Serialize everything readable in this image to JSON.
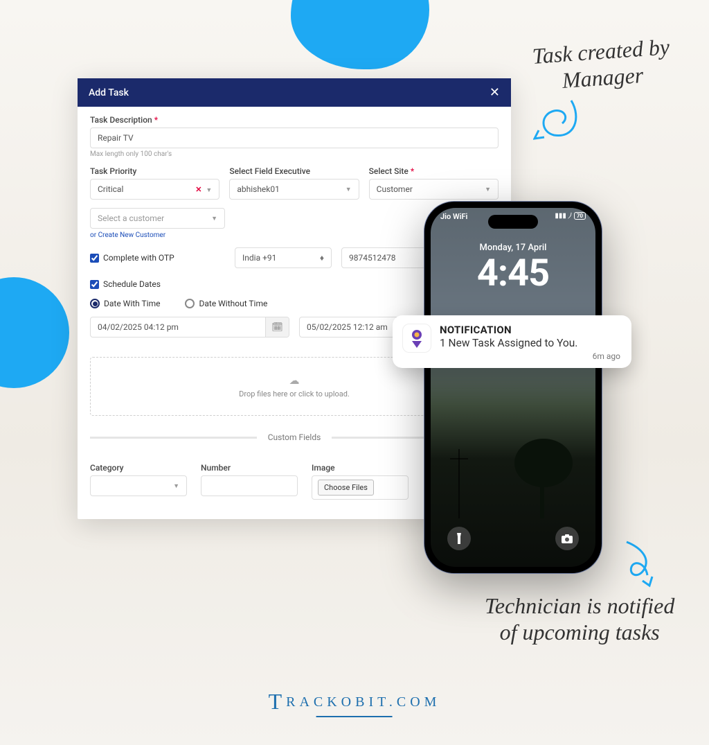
{
  "annotations": {
    "top": "Task created by\nManager",
    "bottom": "Technician is notified\nof upcoming tasks"
  },
  "modal": {
    "title": "Add Task",
    "task_desc_label": "Task Description",
    "task_desc_value": "Repair TV",
    "task_desc_hint": "Max length only 100 char's",
    "priority_label": "Task Priority",
    "priority_value": "Critical",
    "executive_label": "Select Field Executive",
    "executive_value": "abhishek01",
    "site_label": "Select Site",
    "site_value": "Customer",
    "customer_placeholder": "Select a customer",
    "create_customer_link": "or Create New Customer",
    "otp_label": "Complete with OTP",
    "phone_code": "India +91",
    "phone_number": "9874512478",
    "schedule_label": "Schedule Dates",
    "date_with_time": "Date With Time",
    "date_without_time": "Date Without Time",
    "start_date": "04/02/2025 04:12 pm",
    "end_date": "05/02/2025 12:12 am",
    "dropzone": "Drop files here or click to upload.",
    "custom_fields_label": "Custom Fields",
    "category_label": "Category",
    "number_label": "Number",
    "image_label": "Image",
    "choose_files": "Choose Files"
  },
  "phone": {
    "carrier": "Jio WiFi",
    "battery": "70",
    "date": "Monday, 17 April",
    "time": "4:45"
  },
  "notification": {
    "title": "NOTIFICATION",
    "message": "1 New Task Assigned to You.",
    "time": "6m ago"
  },
  "footer": {
    "brand": "RACKOBIT.COM"
  }
}
